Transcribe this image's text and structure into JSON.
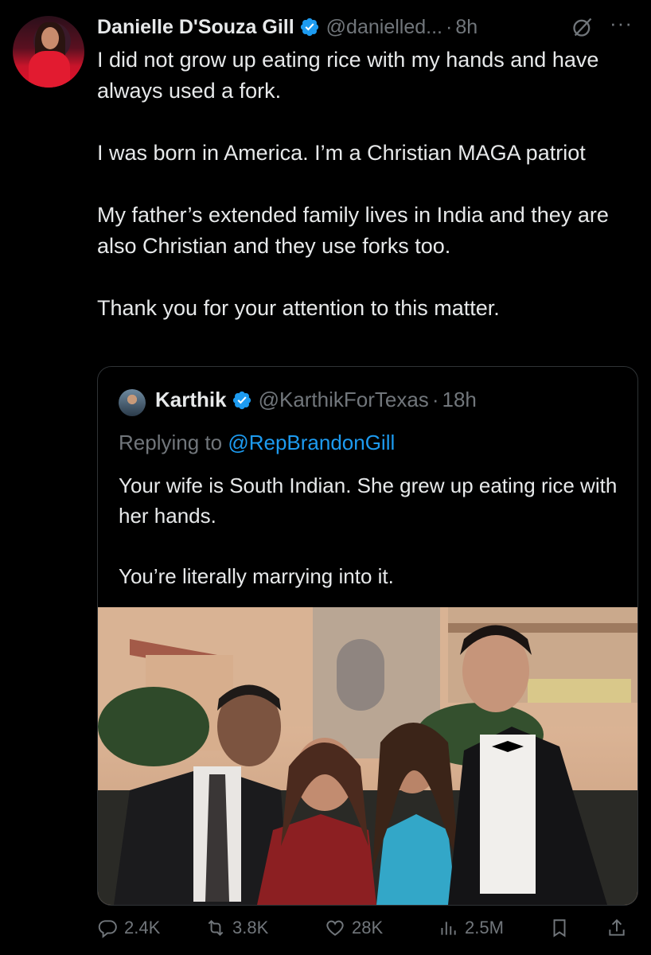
{
  "post": {
    "author_name": "Danielle D'Souza Gill",
    "handle": "@danielled...",
    "separator": "·",
    "time": "8h",
    "more_label": "···",
    "paragraphs": [
      "I did not grow up eating rice with my hands and have always used a fork.",
      "I was born in America. I’m a Christian MAGA patriot",
      "My father’s extended family lives in India and they are also Christian and they use forks too.",
      "Thank you for your attention to this matter."
    ]
  },
  "quoted": {
    "author_name": "Karthik",
    "handle": "@KarthikForTexas",
    "separator": "·",
    "time": "18h",
    "replying_prefix": "Replying to",
    "replying_to": "@RepBrandonGill",
    "paragraphs": [
      "Your wife is South Indian. She grew up eating rice with her hands.",
      "You’re literally marrying into it."
    ]
  },
  "actions": {
    "replies": "2.4K",
    "reposts": "3.8K",
    "likes": "28K",
    "views": "2.5M"
  },
  "colors": {
    "background": "#000000",
    "text": "#e7e9ea",
    "secondary": "#71767b",
    "accent": "#1d9bf0",
    "border": "#2f3336"
  },
  "icons": [
    "verified-badge-icon",
    "grok-icon",
    "more-icon",
    "reply-icon",
    "repost-icon",
    "like-icon",
    "views-icon",
    "bookmark-icon",
    "share-icon"
  ]
}
